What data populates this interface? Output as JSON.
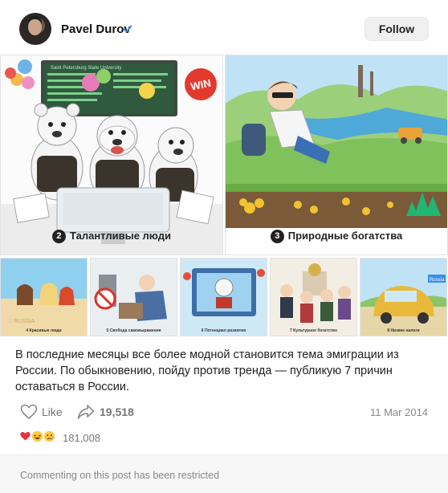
{
  "post": {
    "author": "Pavel Durov",
    "follow_label": "Follow",
    "images": [
      {
        "number": "2",
        "caption": "Талантливые люди"
      },
      {
        "number": "3",
        "caption": "Природные богатства"
      }
    ],
    "thumbnails": [
      {
        "caption": "4 Красивые люди"
      },
      {
        "caption": "5 Свобода самовыражения"
      },
      {
        "caption": "6 Потенциал развития"
      },
      {
        "caption": "7 Культурное богатство"
      },
      {
        "caption": "8 Низкие налоги"
      }
    ],
    "image_text": {
      "university_board": "Saint Petersburg State University",
      "balloon": "WIN",
      "sign_russia": "Russia"
    },
    "text": "В последние месяцы все более модной становится тема эмиграции из России. По обыкновению, пойду против тренда — публикую 7 причин оставаться в России.",
    "like_label": "Like",
    "share_count": "19,518",
    "date": "11 Mar 2014",
    "reaction_count": "181,008",
    "comments_notice": "Commenting on this post has been restricted"
  },
  "colors": {
    "verified": "#3d8ee6",
    "text_muted": "#777777",
    "footer_bg": "#f7f7f8",
    "button_bg": "#f0f0f1"
  }
}
